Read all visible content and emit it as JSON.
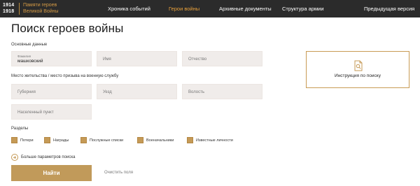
{
  "header": {
    "logo_years_top": "1914",
    "logo_years_bottom": "1918",
    "logo_line1": "Памяти героев",
    "logo_line2": "Великой Войны",
    "nav": [
      {
        "label": "Хроника событий",
        "active": false
      },
      {
        "label": "Герои войны",
        "active": true
      },
      {
        "label": "Архивные документы",
        "active": false
      },
      {
        "label": "Структура армии",
        "active": false
      },
      {
        "label": "Предыдущая версия",
        "active": false
      }
    ]
  },
  "page": {
    "title": "Поиск героев войны"
  },
  "basic": {
    "section_label": "Основные данные",
    "surname_label": "Фамилия",
    "surname_value": "машковский",
    "name_placeholder": "Имя",
    "patronymic_placeholder": "Отчество"
  },
  "residence": {
    "section_label": "Место жительства / место призыва на военную службу",
    "gubernia_placeholder": "Губерния",
    "uezd_placeholder": "Уезд",
    "volost_placeholder": "Волость",
    "settlement_placeholder": "Населенный пункт"
  },
  "instruction": {
    "label": "Инструкция по поиску",
    "icon": "document-search-icon"
  },
  "sections": {
    "label": "Разделы",
    "items": [
      {
        "label": "Потери",
        "checked": true
      },
      {
        "label": "Награды",
        "checked": true
      },
      {
        "label": "Послужные списки",
        "checked": true
      },
      {
        "label": "Военачальники",
        "checked": true
      },
      {
        "label": "Известные личности",
        "checked": true
      }
    ]
  },
  "more_params": "Больше параметров поиска",
  "actions": {
    "find": "Найти",
    "clear": "Очистить поля"
  },
  "colors": {
    "accent": "#c19a5a",
    "nav_active": "#e8a13c",
    "topbar": "#2b2b2b",
    "field_bg": "#f0ecea"
  }
}
